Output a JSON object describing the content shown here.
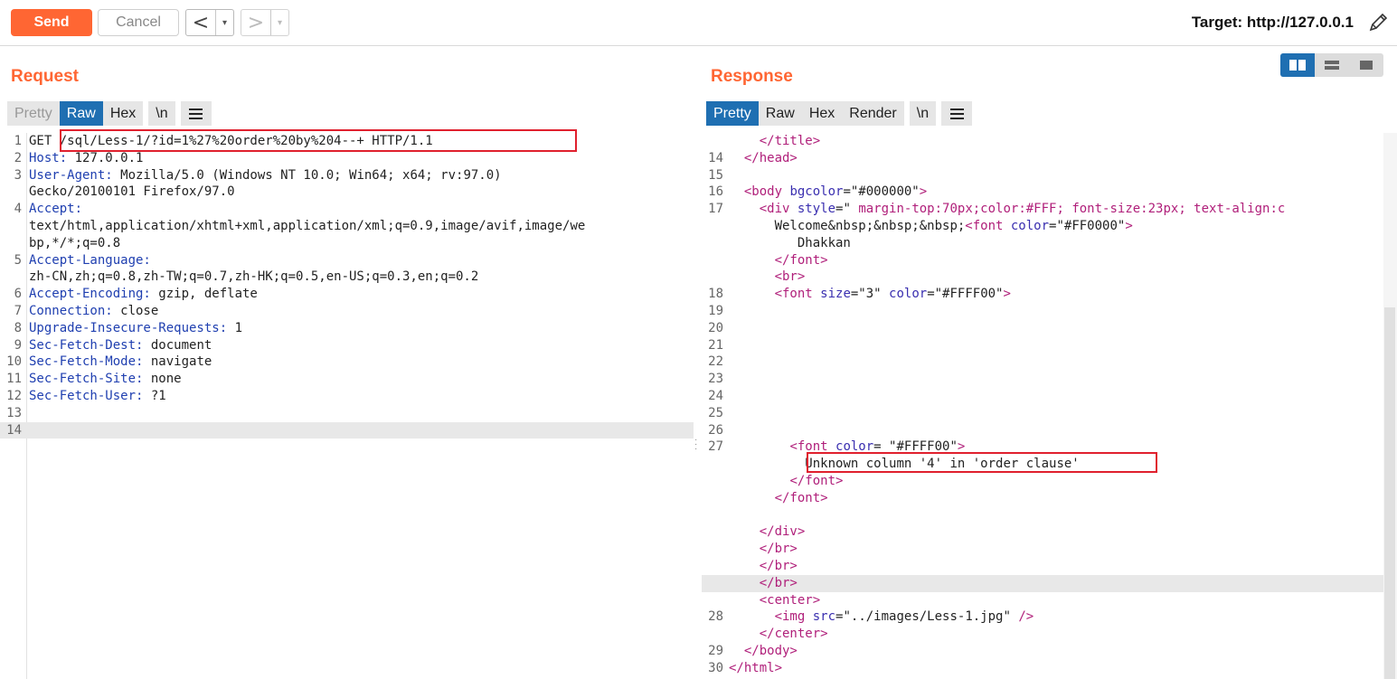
{
  "toolbar": {
    "send": "Send",
    "cancel": "Cancel",
    "back_arrow": "<",
    "forward_arrow": ">",
    "dropdown": "▾",
    "target": "Target: http://127.0.0.1",
    "accent": "#ff6633"
  },
  "request": {
    "title": "Request",
    "tabs": [
      "Pretty",
      "Raw",
      "Hex",
      "\\n"
    ],
    "active_tab": "Raw",
    "lines": [
      {
        "n": "1",
        "text": "GET /sql/Less-1/?id=1%27%20order%20by%204--+ HTTP/1.1"
      },
      {
        "n": "2",
        "key": "Host:",
        "val": " 127.0.0.1"
      },
      {
        "n": "3",
        "key": "User-Agent:",
        "val": " Mozilla/5.0 (Windows NT 10.0; Win64; x64; rv:97.0)"
      },
      {
        "n": "",
        "val": "Gecko/20100101 Firefox/97.0"
      },
      {
        "n": "4",
        "key": "Accept:",
        "val": ""
      },
      {
        "n": "",
        "val": "text/html,application/xhtml+xml,application/xml;q=0.9,image/avif,image/we"
      },
      {
        "n": "",
        "val": "bp,*/*;q=0.8"
      },
      {
        "n": "5",
        "key": "Accept-Language:",
        "val": ""
      },
      {
        "n": "",
        "val": "zh-CN,zh;q=0.8,zh-TW;q=0.7,zh-HK;q=0.5,en-US;q=0.3,en;q=0.2"
      },
      {
        "n": "6",
        "key": "Accept-Encoding:",
        "val": " gzip, deflate"
      },
      {
        "n": "7",
        "key": "Connection:",
        "val": " close"
      },
      {
        "n": "8",
        "key": "Upgrade-Insecure-Requests:",
        "val": " 1"
      },
      {
        "n": "9",
        "key": "Sec-Fetch-Dest:",
        "val": " document"
      },
      {
        "n": "10",
        "key": "Sec-Fetch-Mode:",
        "val": " navigate"
      },
      {
        "n": "11",
        "key": "Sec-Fetch-Site:",
        "val": " none"
      },
      {
        "n": "12",
        "key": "Sec-Fetch-User:",
        "val": " ?1"
      },
      {
        "n": "13",
        "val": ""
      },
      {
        "n": "14",
        "val": "",
        "highlight": true
      }
    ]
  },
  "response": {
    "title": "Response",
    "tabs": [
      "Pretty",
      "Raw",
      "Hex",
      "Render",
      "\\n"
    ],
    "active_tab": "Pretty",
    "lines": [
      {
        "n": "",
        "indent": "    ",
        "html": [
          [
            "tag",
            "</title>"
          ]
        ]
      },
      {
        "n": "14",
        "indent": "  ",
        "html": [
          [
            "tag",
            "</head>"
          ]
        ]
      },
      {
        "n": "15",
        "indent": "",
        "html": []
      },
      {
        "n": "16",
        "indent": "  ",
        "html": [
          [
            "tag",
            "<body "
          ],
          [
            "attr",
            "bgcolor"
          ],
          [
            "val",
            "=\"#000000\""
          ],
          [
            "tag",
            ">"
          ]
        ]
      },
      {
        "n": "17",
        "indent": "    ",
        "html": [
          [
            "tag",
            "<div "
          ],
          [
            "attr",
            "style"
          ],
          [
            "val",
            "=\""
          ],
          [
            "tag",
            " margin-top:70px;color:#FFF; font-size:23px; text-align:c"
          ]
        ]
      },
      {
        "n": "",
        "indent": "      ",
        "html": [
          [
            "txt",
            "Welcome&nbsp;&nbsp;&nbsp;"
          ],
          [
            "tag",
            "<font "
          ],
          [
            "attr",
            "color"
          ],
          [
            "val",
            "=\"#FF0000\""
          ],
          [
            "tag",
            ">"
          ]
        ]
      },
      {
        "n": "",
        "indent": "         ",
        "html": [
          [
            "txt",
            "Dhakkan"
          ]
        ]
      },
      {
        "n": "",
        "indent": "      ",
        "html": [
          [
            "tag",
            "</font>"
          ]
        ]
      },
      {
        "n": "",
        "indent": "      ",
        "html": [
          [
            "tag",
            "<br>"
          ]
        ]
      },
      {
        "n": "18",
        "indent": "      ",
        "html": [
          [
            "tag",
            "<font "
          ],
          [
            "attr",
            "size"
          ],
          [
            "val",
            "=\"3\" "
          ],
          [
            "attr",
            "color"
          ],
          [
            "val",
            "=\"#FFFF00\""
          ],
          [
            "tag",
            ">"
          ]
        ]
      },
      {
        "n": "19",
        "indent": "",
        "html": []
      },
      {
        "n": "20",
        "indent": "",
        "html": []
      },
      {
        "n": "21",
        "indent": "",
        "html": []
      },
      {
        "n": "22",
        "indent": "",
        "html": []
      },
      {
        "n": "23",
        "indent": "",
        "html": []
      },
      {
        "n": "24",
        "indent": "",
        "html": []
      },
      {
        "n": "25",
        "indent": "",
        "html": []
      },
      {
        "n": "26",
        "indent": "",
        "html": []
      },
      {
        "n": "27",
        "indent": "        ",
        "html": [
          [
            "tag",
            "<font "
          ],
          [
            "attr",
            "color"
          ],
          [
            "val",
            "= \"#FFFF00\""
          ],
          [
            "tag",
            ">"
          ]
        ]
      },
      {
        "n": "",
        "indent": "          ",
        "html": [
          [
            "txt",
            "Unknown column '4' in 'order clause'"
          ]
        ]
      },
      {
        "n": "",
        "indent": "        ",
        "html": [
          [
            "tag",
            "</font>"
          ]
        ]
      },
      {
        "n": "",
        "indent": "      ",
        "html": [
          [
            "tag",
            "</font>"
          ]
        ]
      },
      {
        "n": "",
        "indent": "",
        "html": []
      },
      {
        "n": "",
        "indent": "    ",
        "html": [
          [
            "tag",
            "</div>"
          ]
        ]
      },
      {
        "n": "",
        "indent": "    ",
        "html": [
          [
            "tag",
            "</br>"
          ]
        ]
      },
      {
        "n": "",
        "indent": "    ",
        "html": [
          [
            "tag",
            "</br>"
          ]
        ]
      },
      {
        "n": "",
        "indent": "    ",
        "html": [
          [
            "tag",
            "</br>"
          ]
        ],
        "highlight": true
      },
      {
        "n": "",
        "indent": "    ",
        "html": [
          [
            "tag",
            "<center>"
          ]
        ]
      },
      {
        "n": "28",
        "indent": "      ",
        "html": [
          [
            "tag",
            "<img "
          ],
          [
            "attr",
            "src"
          ],
          [
            "val",
            "=\"../images/Less-1.jpg\" "
          ],
          [
            "tag",
            "/>"
          ]
        ]
      },
      {
        "n": "",
        "indent": "    ",
        "html": [
          [
            "tag",
            "</center>"
          ]
        ]
      },
      {
        "n": "29",
        "indent": "  ",
        "html": [
          [
            "tag",
            "</body>"
          ]
        ]
      },
      {
        "n": "30",
        "indent": "",
        "html": [
          [
            "tag",
            "</html>"
          ]
        ]
      }
    ]
  },
  "colors": {
    "accent": "#ff6633",
    "tab_active": "#1f6fb2",
    "highlight_box": "#e0202e"
  }
}
